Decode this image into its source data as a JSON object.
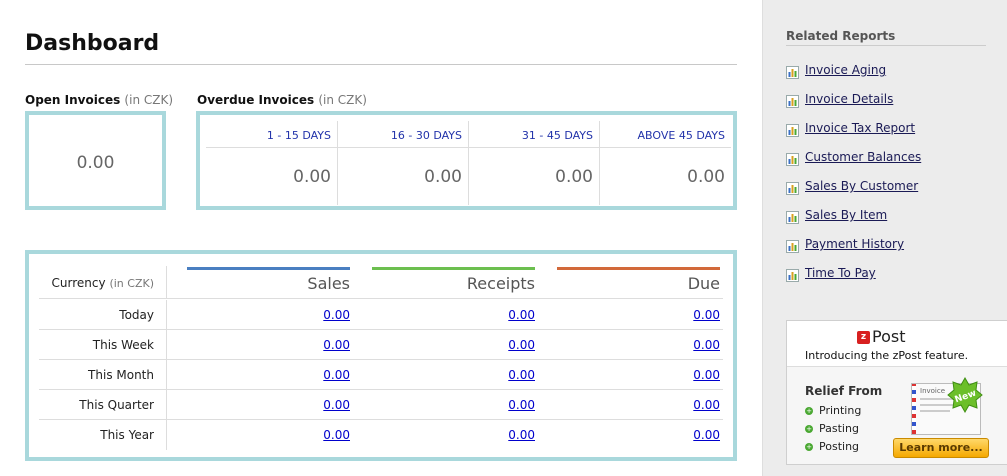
{
  "page": {
    "title": "Dashboard"
  },
  "open_invoices": {
    "label": "Open Invoices",
    "unit": "(in CZK)",
    "value": "0.00"
  },
  "overdue_invoices": {
    "label": "Overdue Invoices",
    "unit": "(in CZK)",
    "columns": [
      {
        "header": "1 - 15 DAYS",
        "value": "0.00"
      },
      {
        "header": "16 - 30 DAYS",
        "value": "0.00"
      },
      {
        "header": "31 - 45 DAYS",
        "value": "0.00"
      },
      {
        "header": "ABOVE 45 DAYS",
        "value": "0.00"
      }
    ]
  },
  "summary": {
    "currency_label": "Currency",
    "currency_unit": "(in CZK)",
    "columns": [
      {
        "header": "Sales",
        "color": "#4a7fc1"
      },
      {
        "header": "Receipts",
        "color": "#6cbf4f"
      },
      {
        "header": "Due",
        "color": "#d2693a"
      }
    ],
    "rows": [
      {
        "label": "Today",
        "sales": "0.00",
        "receipts": "0.00",
        "due": "0.00"
      },
      {
        "label": "This Week",
        "sales": "0.00",
        "receipts": "0.00",
        "due": "0.00"
      },
      {
        "label": "This Month",
        "sales": "0.00",
        "receipts": "0.00",
        "due": "0.00"
      },
      {
        "label": "This Quarter",
        "sales": "0.00",
        "receipts": "0.00",
        "due": "0.00"
      },
      {
        "label": "This Year",
        "sales": "0.00",
        "receipts": "0.00",
        "due": "0.00"
      }
    ]
  },
  "sidebar": {
    "title": "Related Reports",
    "reports": [
      "Invoice Aging",
      "Invoice Details",
      "Invoice Tax Report",
      "Customer Balances",
      "Sales By Customer",
      "Sales By Item",
      "Payment History",
      "Time To Pay"
    ],
    "report_icon": "bar-chart-icon"
  },
  "promo": {
    "badge": "z",
    "brand": "Post",
    "tagline": "Introducing the zPost feature.",
    "relief_title": "Relief From",
    "features": [
      "Printing",
      "Pasting",
      "Posting"
    ],
    "envelope_text": "Invoice",
    "new_badge": "New",
    "button_label": "Learn more..."
  }
}
